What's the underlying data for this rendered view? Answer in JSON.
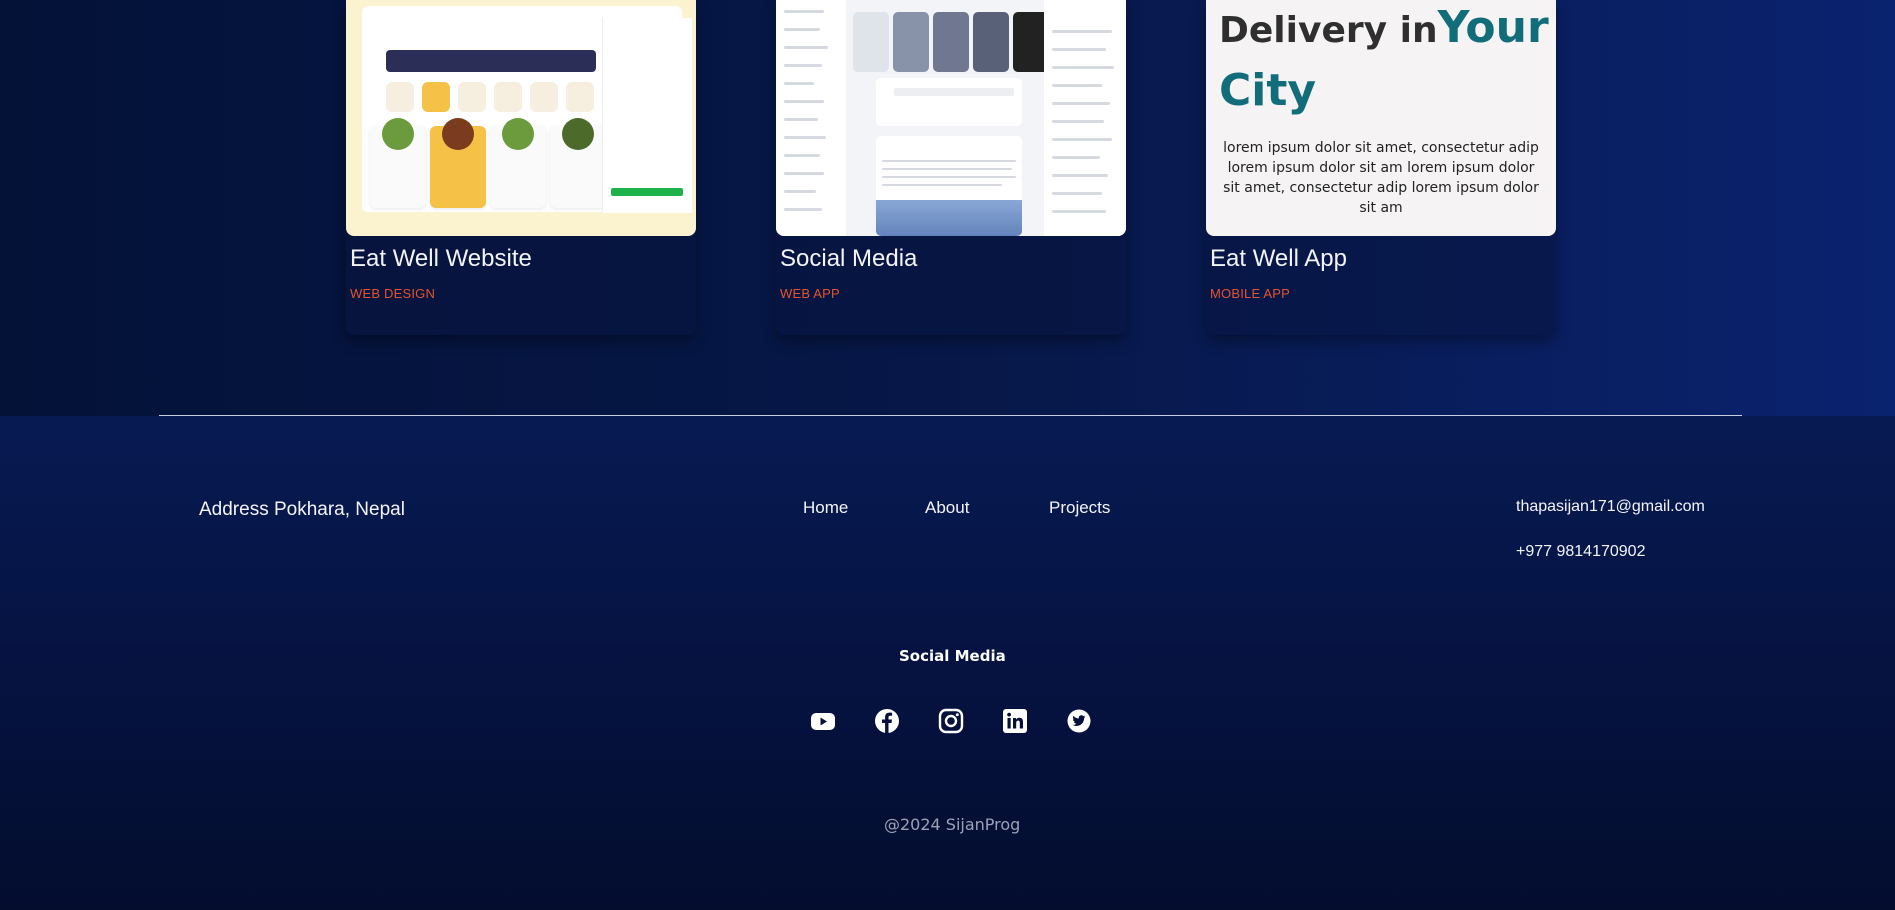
{
  "projects": [
    {
      "title": "Eat Well Website",
      "tag": "WEB DESIGN"
    },
    {
      "title": "Social Media",
      "tag": "WEB APP"
    },
    {
      "title": "Eat Well App",
      "tag": "MOBILE APP",
      "thumb_heading_dark": "Delivery in",
      "thumb_heading_accent_1": "Your",
      "thumb_heading_accent_2": "City",
      "thumb_body": "lorem ipsum dolor sit amet, consectetur adip lorem ipsum dolor sit am lorem ipsum dolor sit amet, consectetur adip lorem ipsum dolor sit am"
    }
  ],
  "footer": {
    "address": "Address Pokhara, Nepal",
    "nav": [
      "Home",
      "About",
      "Projects"
    ],
    "email": "thapasijan171@gmail.com",
    "phone": "+977 9814170902",
    "social_title": "Social Media",
    "social_icons": [
      "youtube-icon",
      "facebook-icon",
      "instagram-icon",
      "linkedin-icon",
      "twitter-icon"
    ],
    "copyright": "@2024 SijanProg"
  },
  "colors": {
    "background": "#05113a",
    "tag": "#e4532f",
    "accent_teal": "#126d7a"
  }
}
